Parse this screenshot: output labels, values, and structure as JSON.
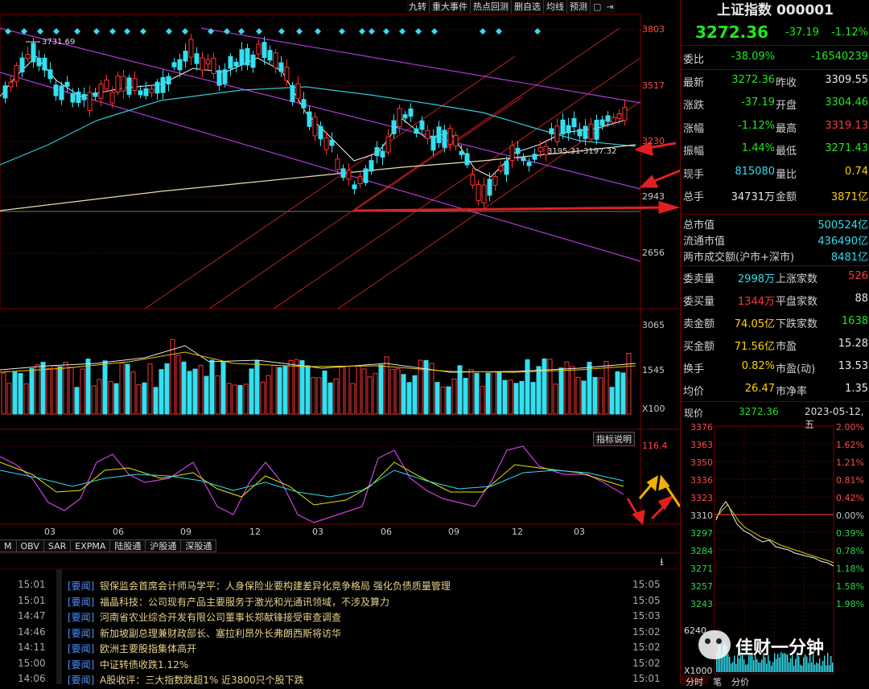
{
  "toolbar": {
    "items": [
      "九转",
      "重大事件",
      "热点回测",
      "删自选",
      "均线",
      "预测"
    ],
    "icons": [
      "lock-icon",
      "pin-icon"
    ]
  },
  "chart_data": [
    {
      "type": "candlestick",
      "title": "",
      "yticks": [
        3803,
        3517,
        3230,
        2943,
        2656
      ],
      "annotations": [
        "3731.69",
        "3195.31-3197.32"
      ],
      "xticks": [
        "03",
        "06",
        "09",
        "12",
        "03",
        "06",
        "09",
        "12",
        "03"
      ],
      "up_color": "#ff3232",
      "down_color": "#33e0f0"
    },
    {
      "type": "bar",
      "title": "",
      "yticks": [
        3065,
        1545
      ],
      "unit_label": "X100"
    },
    {
      "type": "line",
      "title": "",
      "ytick_label": "116.4",
      "button_label": "指标说明"
    },
    {
      "type": "line",
      "title": "",
      "yticks_left": [
        3376,
        3363,
        3350,
        3336,
        3323,
        3310,
        3297,
        3284,
        3271,
        3257,
        3243
      ],
      "yticks_right": [
        "2.00%",
        "1.62%",
        "1.21%",
        "0.81%",
        "0.42%",
        "0.00%",
        "0.39%",
        "0.78%",
        "1.18%",
        "1.58%",
        "1.98%"
      ],
      "volume_ticks": [
        6240
      ],
      "volume_unit": "X1000"
    }
  ],
  "indicator_tabs": [
    "M",
    "OBV",
    "SAR",
    "EXPMA",
    "陆股通",
    "沪股通",
    "深股通"
  ],
  "panel": {
    "name": "上证指数",
    "code": "000001",
    "price": "3272.36",
    "change": "-37.19",
    "change_pct": "-1.12%",
    "rows1": [
      {
        "l": "委比",
        "v": "-38.09%",
        "l2": "",
        "v2": "-16540239"
      },
      {
        "l": "最新",
        "v": "3272.36",
        "l2": "昨收",
        "v2": "3309.55"
      },
      {
        "l": "涨跌",
        "v": "-37.19",
        "l2": "开盘",
        "v2": "3304.46"
      },
      {
        "l": "涨幅",
        "v": "-1.12%",
        "l2": "最高",
        "v2": "3319.13"
      },
      {
        "l": "振幅",
        "v": "1.44%",
        "l2": "最低",
        "v2": "3271.43"
      },
      {
        "l": "现手",
        "v": "815080",
        "l2": "量比",
        "v2": "0.74"
      },
      {
        "l": "总手",
        "v": "34731万",
        "l2": "金额",
        "v2": "3871亿"
      }
    ],
    "rows2": [
      {
        "l": "总市值",
        "v": "500524亿"
      },
      {
        "l": "流通市值",
        "v": "436490亿"
      },
      {
        "l": "两市成交额(沪市+深市)",
        "v": "8481亿"
      }
    ],
    "rows3": [
      {
        "l": "委卖量",
        "v": "2998万",
        "l2": "上涨家数",
        "v2": "526"
      },
      {
        "l": "委买量",
        "v": "1344万",
        "l2": "平盘家数",
        "v2": "88"
      },
      {
        "l": "卖金额",
        "v": "74.05亿",
        "l2": "下跌家数",
        "v2": "1638"
      },
      {
        "l": "买金额",
        "v": "71.56亿",
        "l2": "市盈",
        "v2": "15.28"
      },
      {
        "l": "换手",
        "v": "0.82%",
        "l2": "市盈(动)",
        "v2": "13.53"
      },
      {
        "l": "均价",
        "v": "26.47",
        "l2": "市净率",
        "v2": "1.35"
      }
    ],
    "mini": {
      "label": "现价",
      "price": "3272.36",
      "date": "2023-05-12,五"
    },
    "bottom_tabs": [
      "分时",
      "笔",
      "分价"
    ]
  },
  "news": [
    {
      "time": "15:01",
      "tag": "[要闻]",
      "title": "银保监会首席会计师马学平：人身保险业要构建差异化竞争格局 强化负债质量管理",
      "time2": "15:05"
    },
    {
      "time": "15:01",
      "tag": "[要闻]",
      "title": "福晶科技：公司现有产品主要服务于激光和光通讯领域，不涉及算力",
      "time2": "15:05"
    },
    {
      "time": "14:47",
      "tag": "[要闻]",
      "title": "河南省农业综合开发有限公司董事长郑献锋接受审查调查",
      "time2": "15:03"
    },
    {
      "time": "14:46",
      "tag": "[要闻]",
      "title": "新加坡副总理兼财政部长、塞拉利昂外长弗朗西斯将访华",
      "time2": "15:02"
    },
    {
      "time": "14:11",
      "tag": "[要闻]",
      "title": "欧洲主要股指集体高开",
      "time2": "15:02"
    },
    {
      "time": "15:00",
      "tag": "[要闻]",
      "title": "中证转债收跌1.12%",
      "time2": "15:02"
    },
    {
      "time": "14:06",
      "tag": "[要闻]",
      "title": "A股收评：三大指数跌超1% 近3800只个股下跌",
      "time2": "15:01"
    }
  ],
  "watermark": "佳财一分钟"
}
